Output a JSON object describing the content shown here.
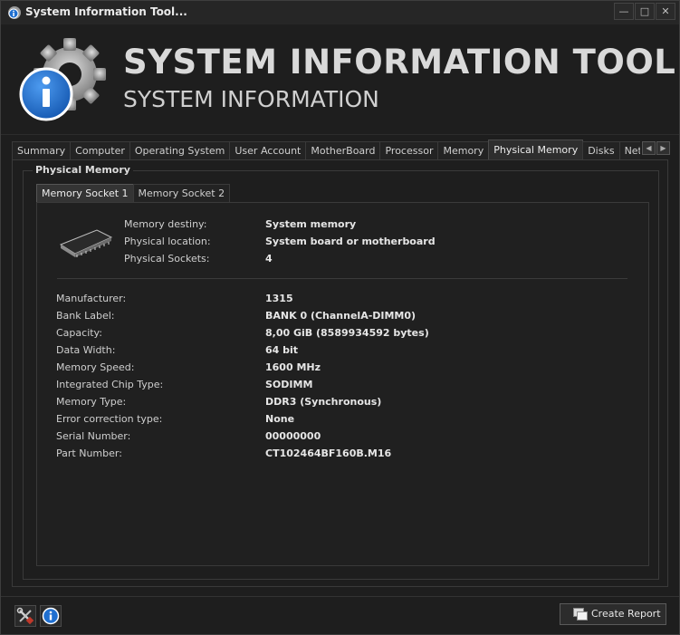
{
  "window": {
    "title": "System Information Tool...",
    "controls": [
      "—",
      "□",
      "✕"
    ]
  },
  "header": {
    "title": "SYSTEM INFORMATION TOOL",
    "subtitle": "SYSTEM INFORMATION"
  },
  "tabs": [
    {
      "label": "Summary"
    },
    {
      "label": "Computer"
    },
    {
      "label": "Operating System"
    },
    {
      "label": "User Account"
    },
    {
      "label": "MotherBoard"
    },
    {
      "label": "Processor"
    },
    {
      "label": "Memory"
    },
    {
      "label": "Physical Memory",
      "active": true
    },
    {
      "label": "Disks"
    },
    {
      "label": "Network Adapter"
    }
  ],
  "group": {
    "title": "Physical Memory",
    "subtabs": [
      {
        "label": "Memory Socket 1",
        "active": true
      },
      {
        "label": "Memory Socket 2"
      }
    ]
  },
  "summary": [
    {
      "label": "Memory destiny:",
      "value": "System memory"
    },
    {
      "label": "Physical location:",
      "value": "System board or motherboard"
    },
    {
      "label": "Physical Sockets:",
      "value": "4"
    }
  ],
  "details": [
    {
      "label": "Manufacturer:",
      "value": "1315"
    },
    {
      "label": "Bank Label:",
      "value": "BANK 0 (ChannelA-DIMM0)"
    },
    {
      "label": "Capacity:",
      "value": "8,00 GiB (8589934592 bytes)"
    },
    {
      "label": "Data Width:",
      "value": "64 bit"
    },
    {
      "label": "Memory Speed:",
      "value": "1600 MHz"
    },
    {
      "label": "Integrated Chip Type:",
      "value": "SODIMM"
    },
    {
      "label": "Memory Type:",
      "value": "DDR3 (Synchronous)"
    },
    {
      "label": "Error correction type:",
      "value": "None"
    },
    {
      "label": "Serial Number:",
      "value": "00000000"
    },
    {
      "label": "Part Number:",
      "value": "CT102464BF160B.M16"
    }
  ],
  "footer": {
    "report_button": "Create Report"
  },
  "colors": {
    "background": "#1e1e1e",
    "accent_blue": "#1f6fd0"
  }
}
